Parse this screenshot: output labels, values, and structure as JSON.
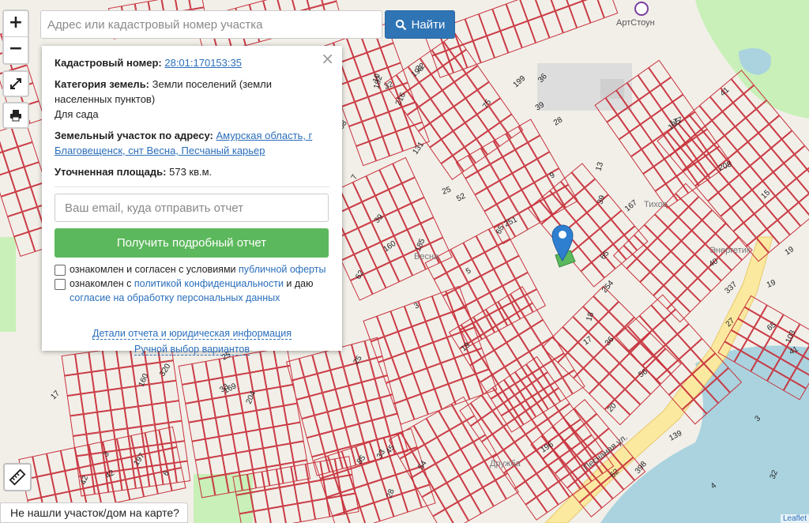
{
  "search": {
    "placeholder": "Адрес или кадастровый номер участка",
    "button_label": "Найти"
  },
  "zoom": {
    "in": "+",
    "out": "−"
  },
  "icons": {
    "search": "search-icon",
    "fullscreen": "fullscreen-icon",
    "print": "print-icon",
    "ruler": "ruler-icon",
    "marker": "map-marker-icon",
    "close": "close-icon"
  },
  "colors": {
    "parcel": "#c8323c",
    "primary": "#2f74b5",
    "success": "#5cb85c",
    "water": "#aad3df",
    "green": "#c8f0b8",
    "road": "#fbe9a0"
  },
  "panel": {
    "close": "×",
    "cadastral_label": "Кадастровый номер:",
    "cadastral_value": "28:01:170153:35",
    "category_label": "Категория земель:",
    "category_value": "Земли поселений (земли населенных пунктов)",
    "usage": "Для сада",
    "address_label": "Земельный участок по адресу:",
    "address_value": "Амурская область, г Благовещенск, снт Весна, Песчаный карьер",
    "area_label": "Уточненная площадь:",
    "area_value": "573 кв.м.",
    "email_placeholder": "Ваш email, куда отправить отчет",
    "report_button": "Получить подробный отчет",
    "consent1_prefix": "ознакомлен и согласен с условиями ",
    "consent1_link": "публичной оферты",
    "consent2_prefix": "ознакомлен с ",
    "consent2_link1": "политикой конфиденциальности",
    "consent2_mid": " и даю ",
    "consent2_link2": "согласие на обработку персональных данных",
    "details_link": "Детали отчета и юридическая информация",
    "manual_link": "Ручной выбор вариантов"
  },
  "not_found": "Не нашли участок/дом на карте?",
  "attribution": "Leaflet",
  "map": {
    "places": [
      "АртСтоун",
      "Тихое",
      "Энергетик",
      "Весна",
      "Дружба",
      "Песчаная ул."
    ],
    "numbers": [
      "3",
      "3",
      "3",
      "7",
      "36",
      "25",
      "5",
      "42",
      "47",
      "665",
      "9",
      "19",
      "52",
      "167",
      "42",
      "40",
      "65",
      "39",
      "32",
      "25",
      "15",
      "185",
      "160",
      "169",
      "204",
      "32",
      "36",
      "17",
      "12",
      "13",
      "30",
      "182",
      "45",
      "216",
      "208",
      "320",
      "196",
      "177",
      "27",
      "139",
      "22",
      "198",
      "12",
      "13",
      "199",
      "31",
      "17",
      "39",
      "17",
      "69",
      "186",
      "180",
      "39",
      "337",
      "197",
      "54",
      "28",
      "62",
      "398",
      "103",
      "10",
      "19",
      "20",
      "33",
      "40",
      "41",
      "28",
      "25",
      "19",
      "168",
      "33",
      "27",
      "135",
      "85",
      "121",
      "93",
      "190",
      "65",
      "41",
      "140",
      "160",
      "231",
      "152",
      "131",
      "4",
      "3",
      "96",
      "18",
      "7",
      "6",
      "56",
      "75",
      "65",
      "154",
      "249",
      "254",
      "251",
      "106",
      "62"
    ]
  }
}
